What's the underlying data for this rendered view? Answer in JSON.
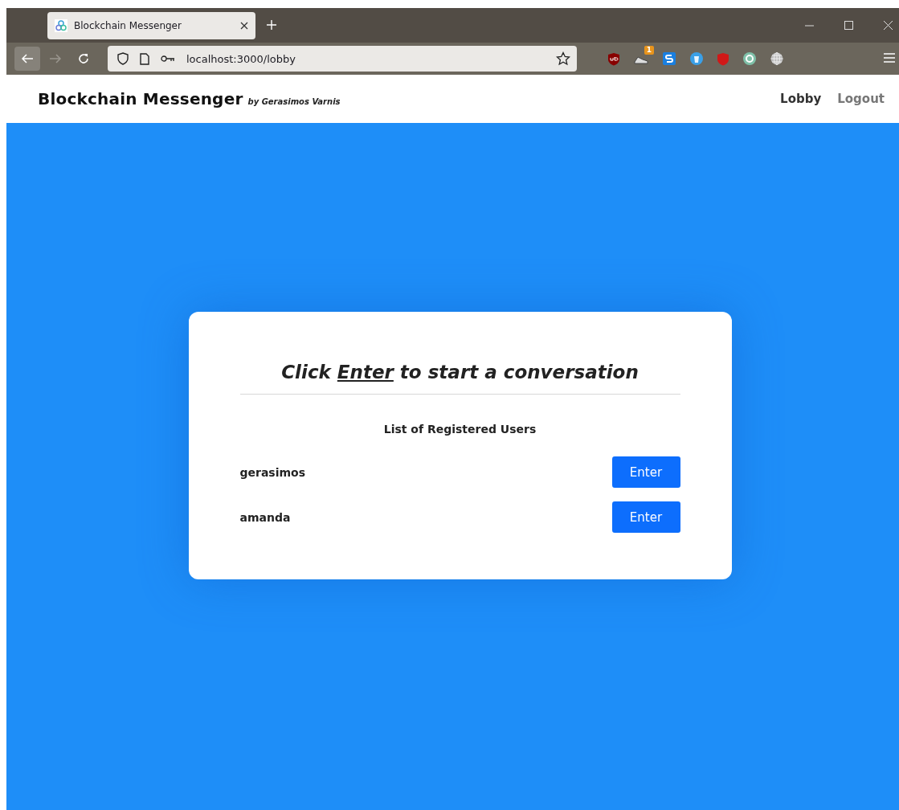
{
  "browser": {
    "tab": {
      "title": "Blockchain Messenger",
      "selected": true
    },
    "url": "localhost:3000/lobby",
    "extension_badge": "1"
  },
  "header": {
    "brand": "Blockchain Messenger",
    "byline": "by Gerasimos Varnis",
    "nav": [
      {
        "label": "Lobby",
        "selected": true
      },
      {
        "label": "Logout",
        "selected": false
      }
    ]
  },
  "card": {
    "heading": {
      "before": "Click ",
      "link": "Enter",
      "after": " to start a conversation"
    },
    "list_title": "List of Registered Users",
    "users": [
      {
        "name": "gerasimos",
        "button": "Enter"
      },
      {
        "name": "amanda",
        "button": "Enter"
      }
    ]
  }
}
